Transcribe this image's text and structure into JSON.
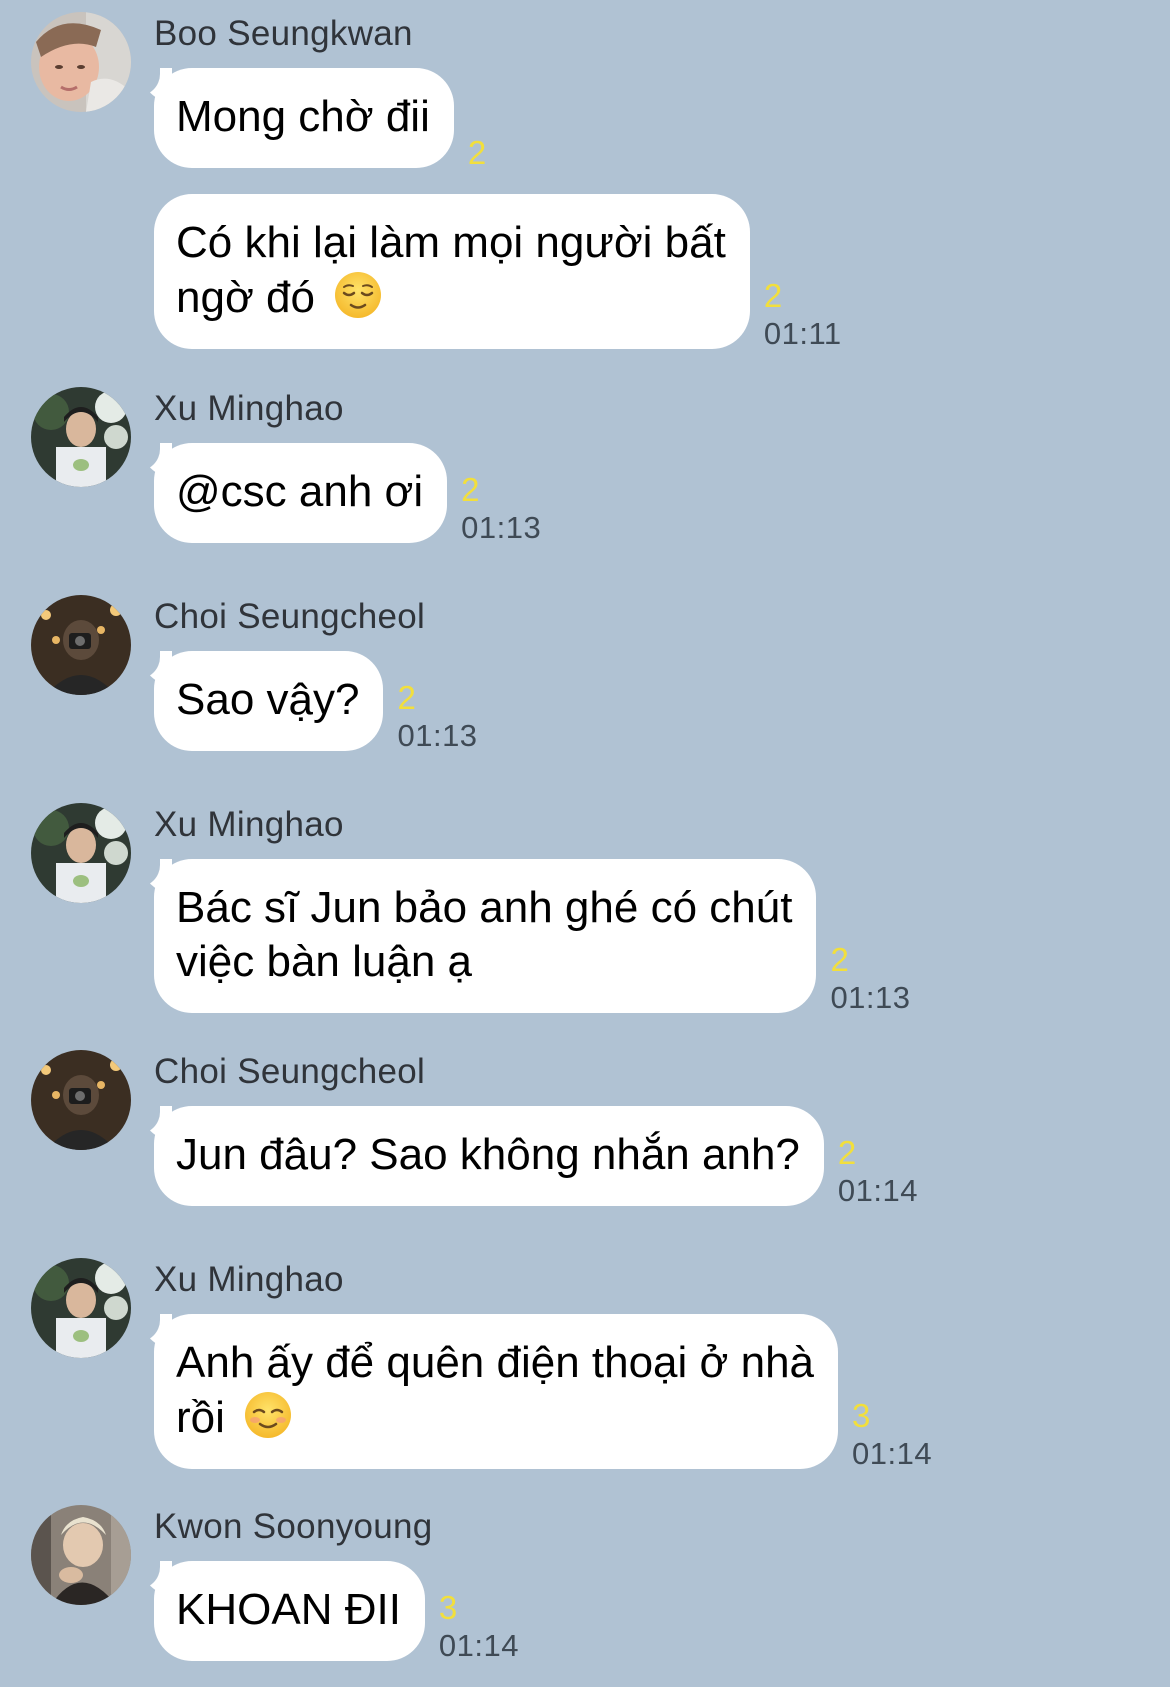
{
  "colors": {
    "background": "#b0c2d3",
    "bubble": "#ffffff",
    "unread": "#f2df3c",
    "time": "#3f4a55",
    "sender": "#30343a"
  },
  "messages": [
    {
      "sender": "Boo Seungkwan",
      "avatar": "avatar-boo-seungkwan",
      "bubbles": [
        {
          "text": "Mong chờ đii",
          "unread": "2",
          "time": ""
        },
        {
          "text_line1": "Có khi lại làm mọi người bất",
          "text_line2": "ngờ đó",
          "emoji": "relieved-face-emoji",
          "unread": "2",
          "time": "01:11"
        }
      ]
    },
    {
      "sender": "Xu Minghao",
      "avatar": "avatar-xu-minghao",
      "bubbles": [
        {
          "text": "@csc anh ơi",
          "unread": "2",
          "time": "01:13"
        }
      ]
    },
    {
      "sender": "Choi Seungcheol",
      "avatar": "avatar-choi-seungcheol",
      "bubbles": [
        {
          "text": "Sao vậy?",
          "unread": "2",
          "time": "01:13"
        }
      ]
    },
    {
      "sender": "Xu Minghao",
      "avatar": "avatar-xu-minghao",
      "bubbles": [
        {
          "text_line1": "Bác sĩ Jun bảo anh ghé có chút",
          "text_line2": "việc bàn luận ạ",
          "unread": "2",
          "time": "01:13"
        }
      ]
    },
    {
      "sender": "Choi Seungcheol",
      "avatar": "avatar-choi-seungcheol",
      "bubbles": [
        {
          "text": "Jun đâu? Sao không nhắn anh?",
          "unread": "2",
          "time": "01:14"
        }
      ]
    },
    {
      "sender": "Xu Minghao",
      "avatar": "avatar-xu-minghao",
      "bubbles": [
        {
          "text_line1": "Anh ấy để quên điện thoại ở nhà",
          "text_line2": "rồi",
          "emoji": "smiling-face-emoji",
          "unread": "3",
          "time": "01:14"
        }
      ]
    },
    {
      "sender": "Kwon Soonyoung",
      "avatar": "avatar-kwon-soonyoung",
      "bubbles": [
        {
          "text": "KHOAN ĐII",
          "unread": "3",
          "time": "01:14"
        }
      ]
    }
  ]
}
